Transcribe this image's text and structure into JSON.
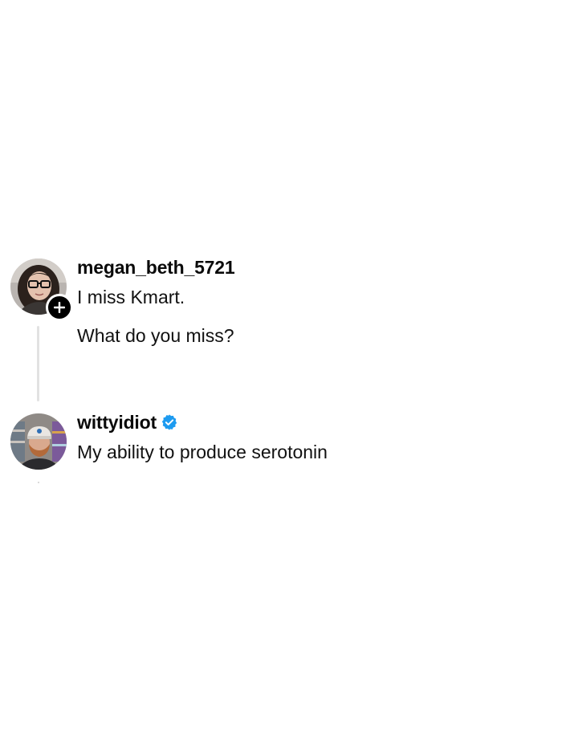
{
  "thread": {
    "posts": [
      {
        "username": "megan_beth_5721",
        "verified": false,
        "show_follow_button": true,
        "avatar_icon": "profile-photo-woman-glasses",
        "lines": [
          "I miss Kmart.",
          "What do you miss?"
        ]
      },
      {
        "username": "wittyidiot",
        "verified": true,
        "avatar_icon": "profile-photo-man-cap",
        "lines": [
          "My ability to produce serotonin"
        ]
      }
    ]
  },
  "colors": {
    "background": "#ffffff",
    "text": "#101010",
    "verified_badge": "#1d9bf0",
    "thread_line": "#e2e2e2",
    "follow_button": "#000000"
  }
}
